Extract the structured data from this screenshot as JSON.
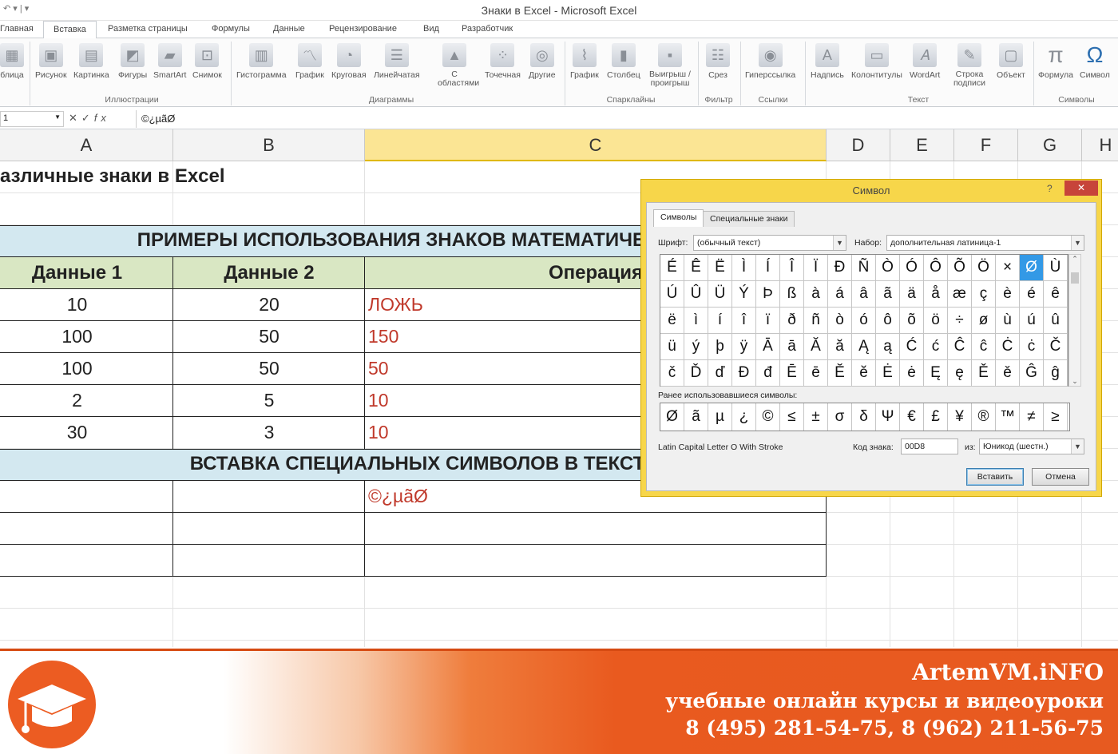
{
  "window": {
    "title": "Знаки в Excel  -  Microsoft Excel"
  },
  "ribbon_tabs": [
    "Главная",
    "Вставка",
    "Разметка страницы",
    "Формулы",
    "Данные",
    "Рецензирование",
    "Вид",
    "Разработчик"
  ],
  "ribbon": {
    "buttons": [
      "блица",
      "Рисунок",
      "Картинка",
      "Фигуры",
      "SmartArt",
      "Снимок",
      "Гистограмма",
      "График",
      "Круговая",
      "Линейчатая",
      "С областями",
      "Точечная",
      "Другие",
      "График",
      "Столбец",
      "Выигрыш / проигрыш",
      "Срез",
      "Гиперссылка",
      "Надпись",
      "Колонтитулы",
      "WordArt",
      "Строка подписи",
      "Объект",
      "Формула",
      "Символ"
    ],
    "groups": [
      "Иллюстрации",
      "Диаграммы",
      "Спарклайны",
      "Фильтр",
      "Ссылки",
      "Текст",
      "Символы"
    ]
  },
  "formula_bar": {
    "name_box": "1",
    "content": "©¿µãØ"
  },
  "columns": [
    "A",
    "B",
    "C",
    "D",
    "E",
    "F",
    "G",
    "H"
  ],
  "sheet": {
    "title": "азличные знаки в Excel",
    "section1": "ПРИМЕРЫ ИСПОЛЬЗОВАНИЯ ЗНАКОВ МАТЕМАТИЧЕСКИХ",
    "headers": [
      "Данные 1",
      "Данные 2",
      "Операция"
    ],
    "rows": [
      {
        "d1": "10",
        "d2": "20",
        "op": "ЛОЖЬ"
      },
      {
        "d1": "100",
        "d2": "50",
        "op": "150"
      },
      {
        "d1": "100",
        "d2": "50",
        "op": "50"
      },
      {
        "d1": "2",
        "d2": "5",
        "op": "10"
      },
      {
        "d1": "30",
        "d2": "3",
        "op": "10"
      }
    ],
    "section2": "ВСТАВКА СПЕЦИАЛЬНЫХ СИМВОЛОВ В ТЕКСТ",
    "inserted": "©¿µãØ"
  },
  "dialog": {
    "title": "Символ",
    "help": "?",
    "close": "✕",
    "tabs": [
      "Символы",
      "Специальные знаки"
    ],
    "font_label": "Шрифт:",
    "font_value": "(обычный текст)",
    "set_label": "Набор:",
    "set_value": "дополнительная латиница-1",
    "symbols": [
      "É",
      "Ê",
      "Ë",
      "Ì",
      "Í",
      "Î",
      "Ï",
      "Ð",
      "Ñ",
      "Ò",
      "Ó",
      "Ô",
      "Õ",
      "Ö",
      "×",
      "Ø",
      "Ù",
      "Ú",
      "Û",
      "Ü",
      "Ý",
      "Þ",
      "ß",
      "à",
      "á",
      "â",
      "ã",
      "ä",
      "å",
      "æ",
      "ç",
      "è",
      "é",
      "ê",
      "ë",
      "ì",
      "í",
      "î",
      "ï",
      "ð",
      "ñ",
      "ò",
      "ó",
      "ô",
      "õ",
      "ö",
      "÷",
      "ø",
      "ù",
      "ú",
      "û",
      "ü",
      "ý",
      "þ",
      "ÿ",
      "Ā",
      "ā",
      "Ă",
      "ă",
      "Ą",
      "ą",
      "Ć",
      "ć",
      "Ĉ",
      "ĉ",
      "Ċ",
      "ċ",
      "Č",
      "č",
      "Ď",
      "ď",
      "Đ",
      "đ",
      "Ē",
      "ē",
      "Ĕ",
      "ĕ",
      "Ė",
      "ė",
      "Ę",
      "ę",
      "Ě",
      "ě",
      "Ĝ",
      "ĝ"
    ],
    "recent_label": "Ранее использовавшиеся символы:",
    "recent": [
      "Ø",
      "ã",
      "µ",
      "¿",
      "©",
      "≤",
      "±",
      "σ",
      "δ",
      "Ψ",
      "€",
      "£",
      "¥",
      "®",
      "™",
      "≠",
      "≥"
    ],
    "char_name": "Latin Capital Letter O With Stroke",
    "code_label": "Код знака:",
    "code_value": "00D8",
    "from_label": "из:",
    "from_value": "Юникод (шестн.)",
    "insert": "Вставить",
    "cancel": "Отмена"
  },
  "footer": {
    "site": "ArtemVM.iNFO",
    "tagline": "учебные онлайн курсы и видеоуроки",
    "phones": "8 (495) 281-54-75, 8 (962) 211-56-75"
  }
}
